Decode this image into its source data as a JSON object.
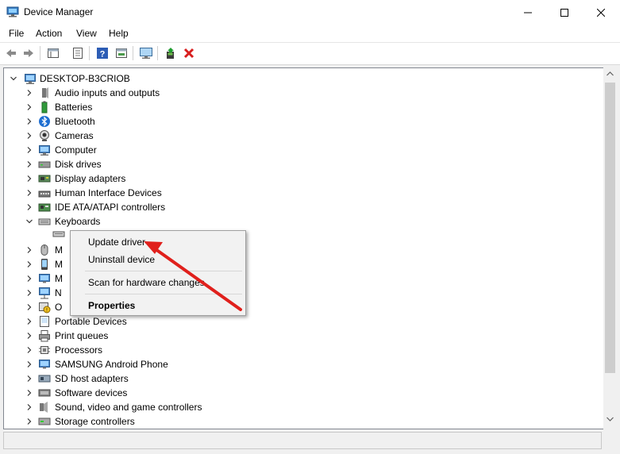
{
  "window": {
    "title": "Device Manager",
    "icon": "device-manager-icon"
  },
  "menu": [
    "File",
    "Action",
    "View",
    "Help"
  ],
  "toolbar": {
    "buttons": [
      "back-icon",
      "forward-icon",
      "properties-panel-icon",
      "properties-icon",
      "help-icon",
      "show-hidden-icon",
      "scan-hardware-icon",
      "update-driver-icon",
      "uninstall-icon"
    ]
  },
  "tree": {
    "root": "DESKTOP-B3CRIOB",
    "nodes": [
      {
        "label": "Audio inputs and outputs",
        "icon": "speaker-icon"
      },
      {
        "label": "Batteries",
        "icon": "battery-icon"
      },
      {
        "label": "Bluetooth",
        "icon": "bluetooth-icon"
      },
      {
        "label": "Cameras",
        "icon": "camera-icon"
      },
      {
        "label": "Computer",
        "icon": "computer-icon"
      },
      {
        "label": "Disk drives",
        "icon": "disk-icon"
      },
      {
        "label": "Display adapters",
        "icon": "display-icon"
      },
      {
        "label": "Human Interface Devices",
        "icon": "hid-icon"
      },
      {
        "label": "IDE ATA/ATAPI controllers",
        "icon": "ide-icon"
      },
      {
        "label": "Keyboards",
        "icon": "keyboard-icon",
        "expanded": true
      },
      {
        "label": "M",
        "icon": "mouse-icon",
        "partial": true
      },
      {
        "label": "M",
        "icon": "monitor-icon",
        "partial": true
      },
      {
        "label": "M",
        "icon": "monitor-icon",
        "partial": true
      },
      {
        "label": "N",
        "icon": "network-icon",
        "partial": true
      },
      {
        "label": "O",
        "icon": "other-icon",
        "partial": true
      },
      {
        "label": "Portable Devices",
        "icon": "portable-icon"
      },
      {
        "label": "Print queues",
        "icon": "printer-icon"
      },
      {
        "label": "Processors",
        "icon": "processor-icon"
      },
      {
        "label": "SAMSUNG Android Phone",
        "icon": "phone-icon"
      },
      {
        "label": "SD host adapters",
        "icon": "sd-icon"
      },
      {
        "label": "Software devices",
        "icon": "software-icon"
      },
      {
        "label": "Sound, video and game controllers",
        "icon": "sound-icon"
      },
      {
        "label": "Storage controllers",
        "icon": "storage-icon"
      }
    ]
  },
  "context_menu": {
    "items": [
      {
        "label": "Update driver"
      },
      {
        "label": "Uninstall device"
      },
      {
        "label": "Scan for hardware changes"
      },
      {
        "label": "Properties",
        "bold": true
      }
    ]
  },
  "colors": {
    "accent": "#0078d7",
    "arrow": "#e0201c",
    "selection": "#cce8ff"
  }
}
